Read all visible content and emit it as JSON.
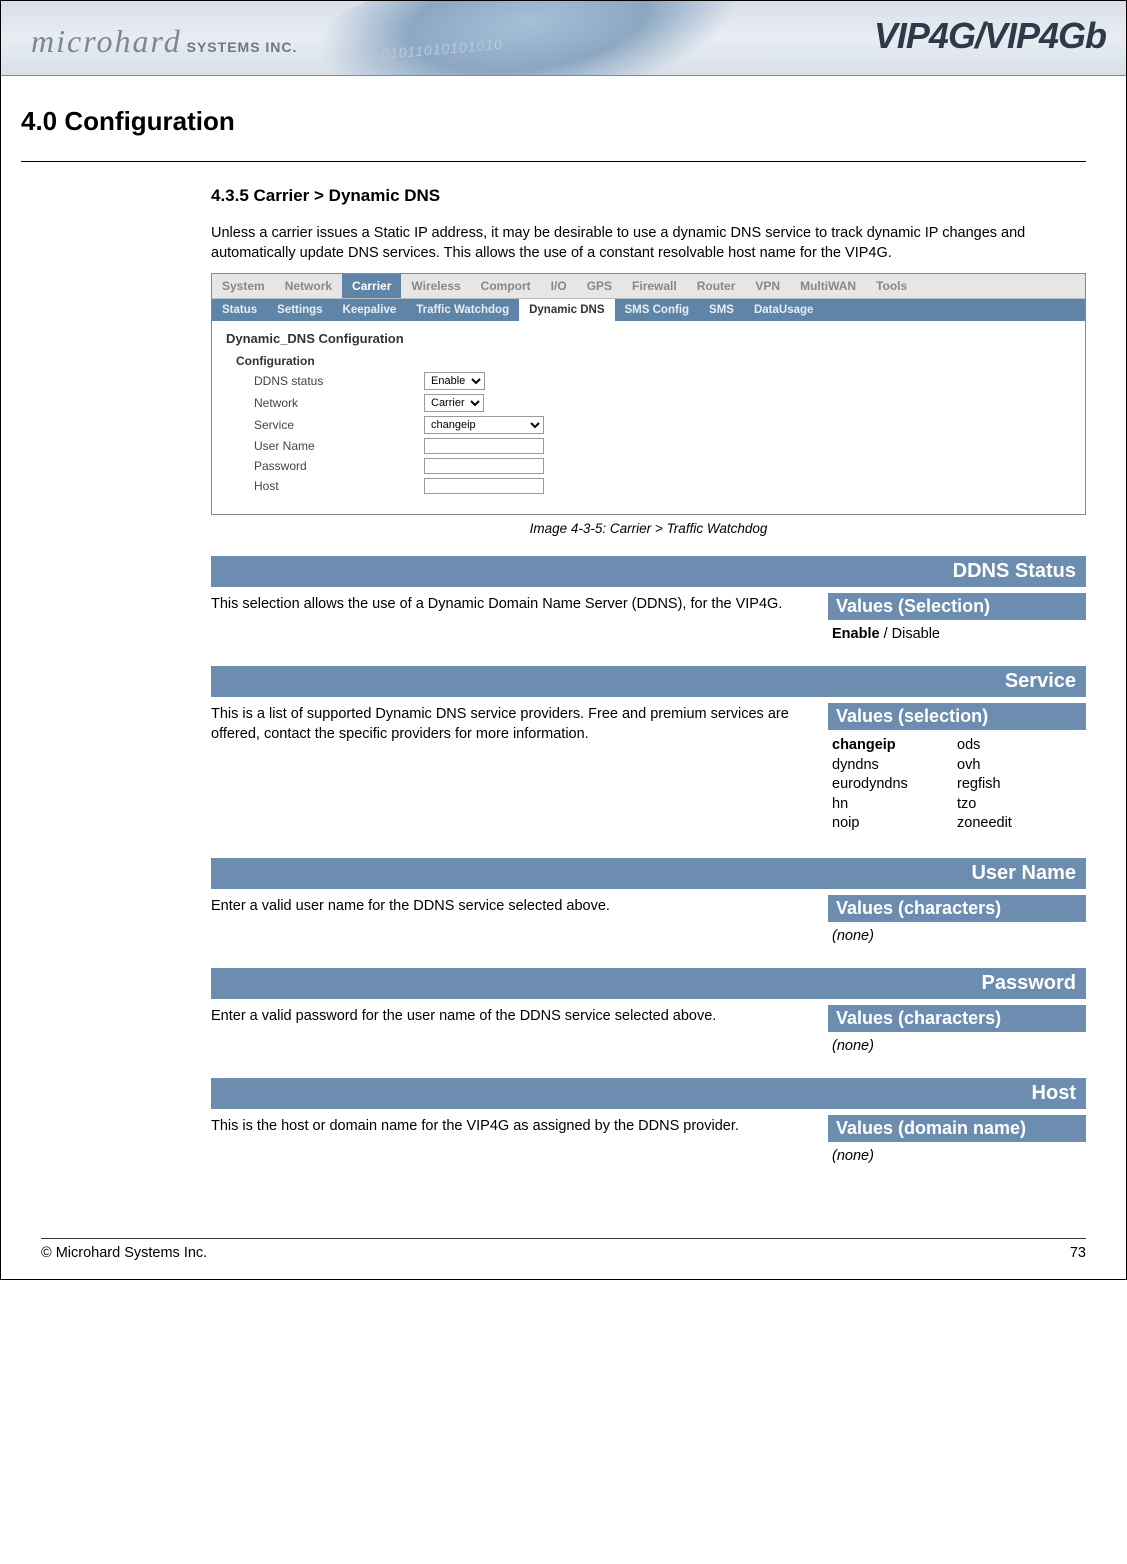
{
  "banner": {
    "brand_left_main": "microhard",
    "brand_left_sub": " SYSTEMS INC.",
    "brand_right": "VIP4G/VIP4Gb",
    "binary": "01011010101010"
  },
  "chapter_title": "4.0  Configuration",
  "section_title": "4.3.5 Carrier > Dynamic DNS",
  "intro": "Unless a carrier issues a Static IP address, it may be desirable to use a dynamic DNS service to track dynamic IP changes and automatically update DNS services. This allows the use of a constant resolvable host name for the VIP4G.",
  "screenshot": {
    "tabs1": [
      "System",
      "Network",
      "Carrier",
      "Wireless",
      "Comport",
      "I/O",
      "GPS",
      "Firewall",
      "Router",
      "VPN",
      "MultiWAN",
      "Tools"
    ],
    "tabs1_active": "Carrier",
    "tabs2": [
      "Status",
      "Settings",
      "Keepalive",
      "Traffic Watchdog",
      "Dynamic DNS",
      "SMS Config",
      "SMS",
      "DataUsage"
    ],
    "tabs2_active": "Dynamic DNS",
    "heading": "Dynamic_DNS Configuration",
    "sub": "Configuration",
    "rows": {
      "ddns_status_label": "DDNS status",
      "ddns_status_value": "Enable",
      "network_label": "Network",
      "network_value": "Carrier",
      "service_label": "Service",
      "service_value": "changeip",
      "username_label": "User Name",
      "password_label": "Password",
      "host_label": "Host"
    }
  },
  "img_caption": "Image 4-3-5:  Carrier  > Traffic Watchdog",
  "params": [
    {
      "title": "DDNS Status",
      "desc": "This selection allows the use of a Dynamic Domain Name Server (DDNS), for the VIP4G.",
      "values_title": "Values (Selection)",
      "values_type": "enable",
      "v_bold": "Enable",
      "v_sep": " / ",
      "v_rest": "Disable"
    },
    {
      "title": "Service",
      "desc": "This is a list of supported Dynamic DNS service providers. Free and premium services are offered, contact the specific providers for more information.",
      "values_title": "Values (selection)",
      "values_type": "cols",
      "col1": [
        "changeip",
        "dyndns",
        "eurodyndns",
        "hn",
        "noip"
      ],
      "col2": [
        "ods",
        "ovh",
        "regfish",
        "tzo",
        "zoneedit"
      ]
    },
    {
      "title": "User Name",
      "desc": "Enter a valid user name for the DDNS service selected above.",
      "values_title": "Values (characters)",
      "values_type": "none",
      "none_text": "(none)"
    },
    {
      "title": "Password",
      "desc": "Enter a valid password for the user name of the DDNS service selected above.",
      "values_title": "Values (characters)",
      "values_type": "none",
      "none_text": "(none)"
    },
    {
      "title": "Host",
      "desc": "This is the host or domain name for the VIP4G as assigned by the DDNS provider.",
      "values_title": "Values (domain name)",
      "values_type": "none",
      "none_text": "(none)"
    }
  ],
  "footer": {
    "left": "© Microhard Systems Inc.",
    "right": "73"
  }
}
